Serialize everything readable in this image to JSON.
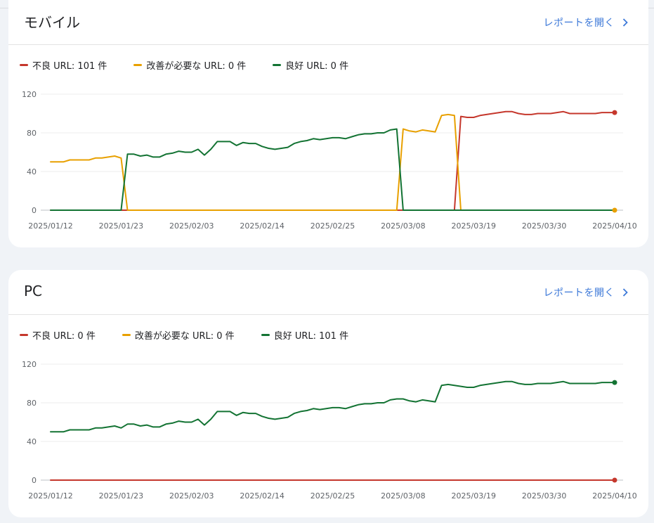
{
  "cards": [
    {
      "id": "mobile",
      "title": "モバイル",
      "open_report_label": "レポートを開く",
      "legend": [
        {
          "label": "不良 URL: 101 件",
          "color": "#c5372c"
        },
        {
          "label": "改善が必要な URL: 0 件",
          "color": "#e8a000"
        },
        {
          "label": "良好 URL: 0 件",
          "color": "#137333"
        }
      ]
    },
    {
      "id": "pc",
      "title": "PC",
      "open_report_label": "レポートを開く",
      "legend": [
        {
          "label": "不良 URL: 0 件",
          "color": "#c5372c"
        },
        {
          "label": "改善が必要な URL: 0 件",
          "color": "#e8a000"
        },
        {
          "label": "良好 URL: 101 件",
          "color": "#137333"
        }
      ]
    }
  ],
  "chart_data": [
    {
      "type": "line",
      "ylim": [
        0,
        120
      ],
      "yticks": [
        0,
        40,
        80,
        120
      ],
      "xlim": [
        0,
        88
      ],
      "xticks": [
        {
          "i": 0,
          "label": "2025/01/12"
        },
        {
          "i": 11,
          "label": "2025/01/23"
        },
        {
          "i": 22,
          "label": "2025/02/03"
        },
        {
          "i": 33,
          "label": "2025/02/14"
        },
        {
          "i": 44,
          "label": "2025/02/25"
        },
        {
          "i": 55,
          "label": "2025/03/08"
        },
        {
          "i": 66,
          "label": "2025/03/19"
        },
        {
          "i": 77,
          "label": "2025/03/30"
        },
        {
          "i": 88,
          "label": "2025/04/10"
        }
      ],
      "grid": true,
      "series": [
        {
          "name": "不良 URL",
          "color": "#c5372c",
          "end_marker": true,
          "x": [
            0,
            63,
            64,
            65,
            66,
            67,
            68,
            69,
            70,
            71,
            72,
            73,
            74,
            75,
            76,
            77,
            78,
            79,
            80,
            81,
            82,
            83,
            84,
            85,
            86,
            87,
            88
          ],
          "y": [
            0,
            0,
            97,
            96,
            96,
            98,
            99,
            100,
            101,
            102,
            102,
            100,
            99,
            99,
            100,
            100,
            100,
            101,
            102,
            100,
            100,
            100,
            100,
            100,
            101,
            101,
            101
          ]
        },
        {
          "name": "改善が必要な URL",
          "color": "#e8a000",
          "end_marker": true,
          "x": [
            0,
            1,
            2,
            3,
            4,
            5,
            6,
            7,
            8,
            9,
            10,
            11,
            12,
            54,
            55,
            56,
            57,
            58,
            59,
            60,
            61,
            62,
            63,
            64,
            88
          ],
          "y": [
            50,
            50,
            50,
            52,
            52,
            52,
            52,
            54,
            54,
            55,
            56,
            54,
            0,
            0,
            84,
            82,
            81,
            83,
            82,
            81,
            98,
            99,
            98,
            0,
            0
          ]
        },
        {
          "name": "良好 URL",
          "color": "#137333",
          "end_marker": false,
          "x": [
            0,
            11,
            12,
            13,
            14,
            15,
            16,
            17,
            18,
            19,
            20,
            21,
            22,
            23,
            24,
            25,
            26,
            27,
            28,
            29,
            30,
            31,
            32,
            33,
            34,
            35,
            36,
            37,
            38,
            39,
            40,
            41,
            42,
            43,
            44,
            45,
            46,
            47,
            48,
            49,
            50,
            51,
            52,
            53,
            54,
            55,
            63,
            64,
            88
          ],
          "y": [
            0,
            0,
            58,
            58,
            56,
            57,
            55,
            55,
            58,
            59,
            61,
            60,
            60,
            63,
            57,
            63,
            71,
            71,
            71,
            67,
            70,
            69,
            69,
            66,
            64,
            63,
            64,
            65,
            69,
            71,
            72,
            74,
            73,
            74,
            75,
            75,
            74,
            76,
            78,
            79,
            79,
            80,
            80,
            83,
            84,
            0,
            0,
            0,
            0
          ]
        }
      ]
    },
    {
      "type": "line",
      "ylim": [
        0,
        120
      ],
      "yticks": [
        0,
        40,
        80,
        120
      ],
      "xlim": [
        0,
        88
      ],
      "xticks": [
        {
          "i": 0,
          "label": "2025/01/12"
        },
        {
          "i": 11,
          "label": "2025/01/23"
        },
        {
          "i": 22,
          "label": "2025/02/03"
        },
        {
          "i": 33,
          "label": "2025/02/14"
        },
        {
          "i": 44,
          "label": "2025/02/25"
        },
        {
          "i": 55,
          "label": "2025/03/08"
        },
        {
          "i": 66,
          "label": "2025/03/19"
        },
        {
          "i": 77,
          "label": "2025/03/30"
        },
        {
          "i": 88,
          "label": "2025/04/10"
        }
      ],
      "grid": true,
      "series": [
        {
          "name": "不良 URL",
          "color": "#c5372c",
          "end_marker": true,
          "x": [
            0,
            88
          ],
          "y": [
            0,
            0
          ]
        },
        {
          "name": "良好 URL",
          "color": "#137333",
          "end_marker": true,
          "x": [
            0,
            1,
            2,
            3,
            4,
            5,
            6,
            7,
            8,
            9,
            10,
            11,
            12,
            13,
            14,
            15,
            16,
            17,
            18,
            19,
            20,
            21,
            22,
            23,
            24,
            25,
            26,
            27,
            28,
            29,
            30,
            31,
            32,
            33,
            34,
            35,
            36,
            37,
            38,
            39,
            40,
            41,
            42,
            43,
            44,
            45,
            46,
            47,
            48,
            49,
            50,
            51,
            52,
            53,
            54,
            55,
            56,
            57,
            58,
            59,
            60,
            61,
            62,
            63,
            64,
            65,
            66,
            67,
            68,
            69,
            70,
            71,
            72,
            73,
            74,
            75,
            76,
            77,
            78,
            79,
            80,
            81,
            82,
            83,
            84,
            85,
            86,
            87,
            88
          ],
          "y": [
            50,
            50,
            50,
            52,
            52,
            52,
            52,
            54,
            54,
            55,
            56,
            54,
            58,
            58,
            56,
            57,
            55,
            55,
            58,
            59,
            61,
            60,
            60,
            63,
            57,
            63,
            71,
            71,
            71,
            67,
            70,
            69,
            69,
            66,
            64,
            63,
            64,
            65,
            69,
            71,
            72,
            74,
            73,
            74,
            75,
            75,
            74,
            76,
            78,
            79,
            79,
            80,
            80,
            83,
            84,
            84,
            82,
            81,
            83,
            82,
            81,
            98,
            99,
            98,
            97,
            96,
            96,
            98,
            99,
            100,
            101,
            102,
            102,
            100,
            99,
            99,
            100,
            100,
            100,
            101,
            102,
            100,
            100,
            100,
            100,
            100,
            101,
            101,
            101
          ]
        }
      ]
    }
  ]
}
